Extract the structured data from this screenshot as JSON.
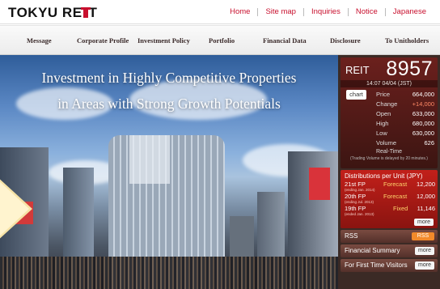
{
  "header": {
    "logo_text": "TOKYU RE",
    "logo_text_end": "T",
    "top_nav": [
      "Home",
      "Site map",
      "Inquiries",
      "Notice",
      "Japanese"
    ]
  },
  "main_nav": [
    "Message",
    "Corporate Profile",
    "Investment Policy",
    "Portfolio",
    "Financial Data",
    "Disclosure",
    "To Unitholders"
  ],
  "hero": {
    "line1": "Investment in Highly Competitive Properties",
    "line2": "in Areas with Strong Growth Potentials"
  },
  "stock": {
    "label": "REIT",
    "code": "8957",
    "time": "14:07 04/04 (JST)",
    "chart_button": "chart",
    "rows": [
      {
        "key": "Price",
        "value": "664,000"
      },
      {
        "key": "Change",
        "value": "+14,000"
      },
      {
        "key": "Open",
        "value": "633,000"
      },
      {
        "key": "High",
        "value": "680,000"
      },
      {
        "key": "Low",
        "value": "630,000"
      },
      {
        "key": "Volume",
        "value": "626"
      }
    ],
    "realtime": "Real-Time",
    "note": "(Trading Volume is delayed by 20 minutes.)"
  },
  "distributions": {
    "title": "Distributions per Unit (JPY)",
    "rows": [
      {
        "fp": "21st FP",
        "sub": "(ending Jan. 2014)",
        "kind": "Forecast",
        "value": "12,200"
      },
      {
        "fp": "20th FP",
        "sub": "(ending Jul. 2013)",
        "kind": "Forecast",
        "value": "12,000"
      },
      {
        "fp": "19th FP",
        "sub": "(ended Jan. 2013)",
        "kind": "Fixed",
        "value": "11,146"
      }
    ],
    "more": "more"
  },
  "side_buttons": {
    "rss": "RSS",
    "rss_badge": "RSS",
    "financial_summary": "Financial Summary",
    "first_time": "For First Time Visitors",
    "more": "more"
  },
  "colors": {
    "brand_red": "#c8102e",
    "panel_dark": "#3b2a25",
    "dist_red": "#c2201a"
  }
}
